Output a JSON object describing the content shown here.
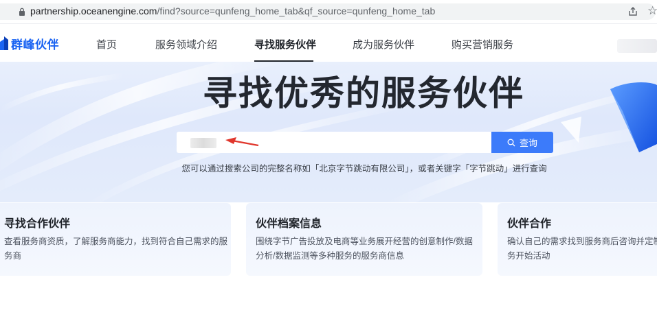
{
  "browser": {
    "url_domain": "partnership.oceanengine.com",
    "url_path": "/find?source=qunfeng_home_tab&qf_source=qunfeng_home_tab"
  },
  "nav": {
    "logo_text": "群峰伙伴",
    "items": [
      {
        "label": "首页"
      },
      {
        "label": "服务领域介绍"
      },
      {
        "label": "寻找服务伙伴",
        "active": true
      },
      {
        "label": "成为服务伙伴"
      },
      {
        "label": "购买营销服务"
      }
    ]
  },
  "hero": {
    "title": "寻找优秀的服务伙伴",
    "search_button": "查询",
    "hint": "您可以通过搜索公司的完整名称如「北京字节跳动有限公司」，或者关键字「字节跳动」进行查询"
  },
  "cards": [
    {
      "title": "寻找合作伙伴",
      "desc": "查看服务商资质，了解服务商能力，找到符合自己需求的服务商"
    },
    {
      "title": "伙伴档案信息",
      "desc": "围绕字节广告投放及电商等业务展开经营的创意制作/数据分析/数据监测等多种服务的服务商信息"
    },
    {
      "title": "伙伴合作",
      "desc": "确认自己的需求找到服务商后咨询并定制服务开始活动"
    }
  ],
  "colors": {
    "accent": "#3c7bfa",
    "brand": "#1b64f2",
    "annotation_arrow": "#e0362c"
  },
  "icons": {
    "lock": "lock-icon",
    "share": "share-icon",
    "star": "star-icon",
    "search": "search-icon",
    "logo": "logo-mark-icon"
  }
}
